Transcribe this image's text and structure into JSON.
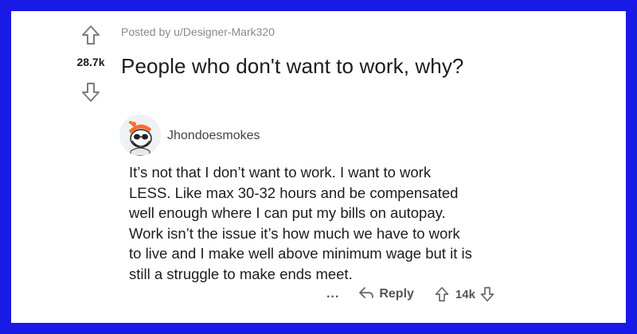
{
  "post": {
    "posted_by": "Posted by u/Designer-Mark320",
    "title": "People who don't want to work, why?",
    "score": "28.7k"
  },
  "comment": {
    "username": "Jhondoesmokes",
    "body_lines": [
      "It’s not that I don’t want to work. I want to work",
      "LESS. Like max 30-32 hours and be compensated",
      "well enough where I can put my bills on autopay.",
      "Work isn’t the issue it’s how much we have to work",
      "to live and I make well above minimum wage but it is",
      "still a struggle to make ends meet."
    ],
    "more_label": "...",
    "reply_label": "Reply",
    "score": "14k"
  },
  "icons": {
    "upvote": "arrow-up-outline",
    "downvote": "arrow-down-outline",
    "reply": "reply-arrow",
    "avatar": "snoo-avatar"
  },
  "colors": {
    "background": "#1a1ae6",
    "card": "#ffffff",
    "text": "#1c1c1c",
    "meta": "#878a8c"
  }
}
